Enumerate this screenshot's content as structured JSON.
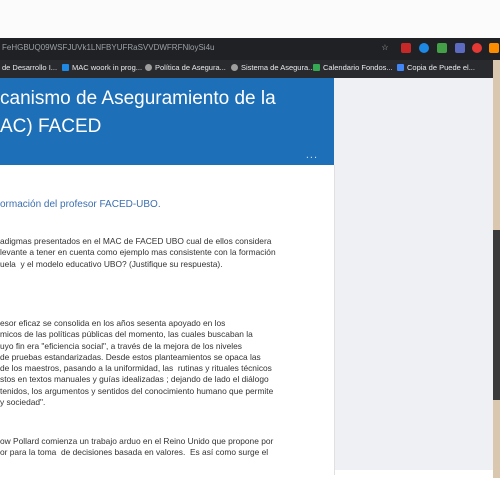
{
  "browser": {
    "url": "FeHGBUQ09WSFJUVk1LNFBYUFRaSVVDWFRFNloySi4u",
    "bookmarks": [
      "de Desarrollo I...",
      "MAC woork in prog...",
      "Política de Asegura...",
      "Sistema de Asegura...",
      "Calendario Fondos...",
      "Copia de Puede el..."
    ]
  },
  "form": {
    "title_line1": "canismo de Aseguramiento de la",
    "title_line2": "AC) FACED",
    "more": "...",
    "section_title": "ormación del profesor FACED-UBO.",
    "question": [
      "adigmas presentados en el MAC de FACED UBO cual de ellos considera",
      "levante a tener en cuenta como ejemplo mas consistente con la formación",
      "uela  y el modelo educativo UBO? (Justifique su respuesta)."
    ],
    "answer1": [
      "esor eficaz se consolida en los años sesenta apoyado en los",
      "micos de las políticas públicas del momento, las cuales buscaban la",
      "uyo fin era \"eficiencia social\", a través de la mejora de los niveles",
      "de pruebas estandarizadas. Desde estos planteamientos se opaca las",
      "de los maestros, pasando a la uniformidad, las  rutinas y rituales técnicos",
      "stos en textos manuales y guías idealizadas ; dejando de lado el diálogo",
      "tenidos, los argumentos y sentidos del conocimiento humano que permite",
      "y sociedad\"."
    ],
    "answer2": [
      "ow Pollard comienza un trabajo arduo en el Reino Unido que propone por",
      "or para la toma  de decisiones basada en valores.  Es así como surge el"
    ]
  }
}
